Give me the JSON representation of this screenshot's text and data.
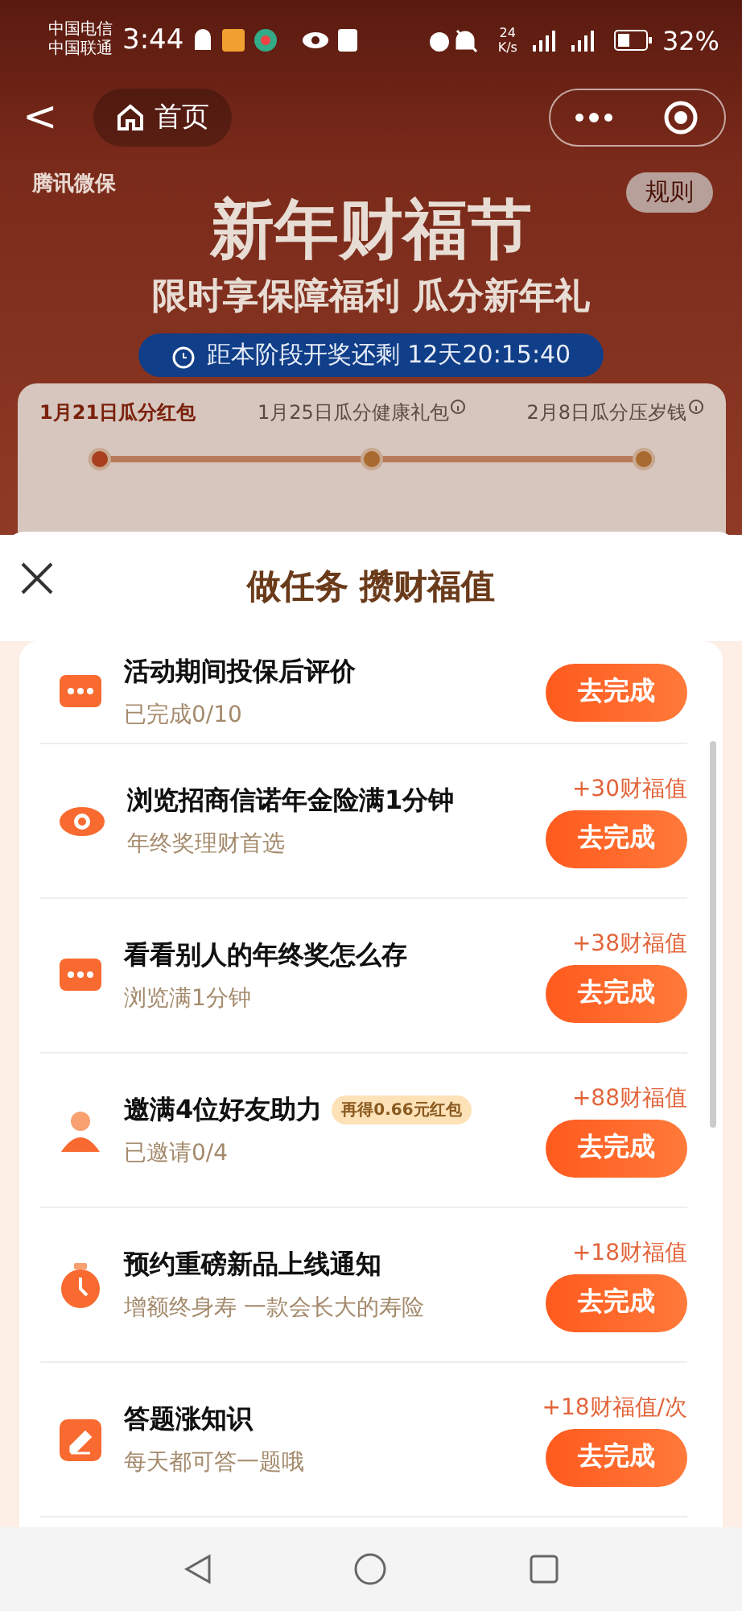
{
  "status_bar": {
    "carriers": [
      "中国电信",
      "中国联通"
    ],
    "time": "3:44",
    "speed": [
      "24",
      "K/s"
    ],
    "battery": "32%"
  },
  "nav": {
    "back": "<",
    "home": "首页"
  },
  "banner": {
    "brand": "腾讯微保",
    "rules": "规则",
    "title": "新年财福节",
    "subtitle": "限时享保障福利 瓜分新年礼",
    "countdown": "距本阶段开奖还剩 12天20:15:40",
    "stages": [
      {
        "label": "1月21日瓜分红包",
        "selected": true,
        "info": false
      },
      {
        "label": "1月25日瓜分健康礼包",
        "selected": false,
        "info": true
      },
      {
        "label": "2月8日瓜分压岁钱",
        "selected": false,
        "info": true
      }
    ]
  },
  "sheet": {
    "title": "做任务 攒财福值",
    "tasks": [
      {
        "kind": "chat",
        "title": "活动期间投保后评价",
        "subtitle": "已完成0/10",
        "button": "去完成"
      },
      {
        "kind": "eye",
        "title": "浏览招商信诺年金险满1分钟",
        "subtitle": "年终奖理财首选",
        "reward": "+30财福值",
        "button": "去完成"
      },
      {
        "kind": "chat",
        "title": "看看别人的年终奖怎么存",
        "subtitle": "浏览满1分钟",
        "reward": "+38财福值",
        "button": "去完成"
      },
      {
        "kind": "person",
        "title": "邀满4位好友助力",
        "tag": "再得0.66元红包",
        "subtitle": "已邀请0/4",
        "reward": "+88财福值",
        "button": "去完成"
      },
      {
        "kind": "clock",
        "title": "预约重磅新品上线通知",
        "subtitle": "增额终身寿 一款会长大的寿险",
        "reward": "+18财福值",
        "button": "去完成"
      },
      {
        "kind": "pencil",
        "title": "答题涨知识",
        "subtitle": "每天都可答一题哦",
        "reward": "+18财福值/次",
        "button": "去完成"
      }
    ]
  }
}
